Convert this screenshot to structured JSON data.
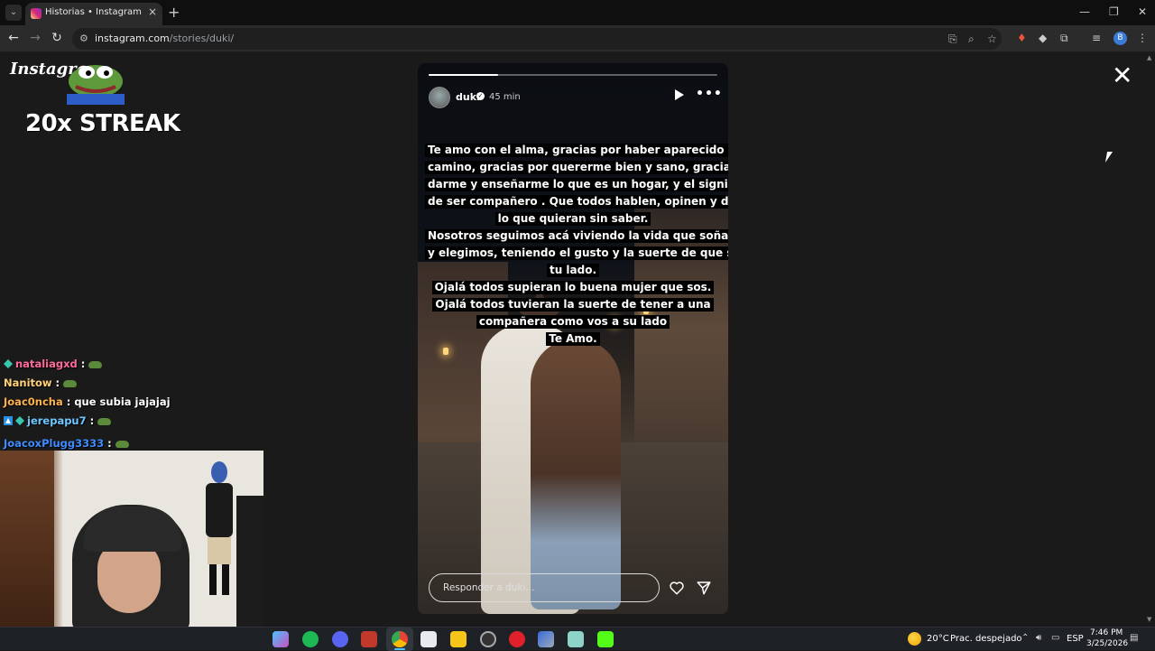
{
  "browser": {
    "tab_title": "Historias • Instagram",
    "tab_close": "×",
    "new_tab": "+",
    "url_domain": "instagram.com",
    "url_path": "/stories/duki/"
  },
  "overlay": {
    "logo_text": "Instagram",
    "streak": "20x STREAK"
  },
  "chat": [
    {
      "user": "nataliagxd",
      "color": "#ff6b9a",
      "message": "",
      "emote": true,
      "badge": "teal"
    },
    {
      "user": "Nanitow",
      "color": "#ffd27a",
      "message": "",
      "emote": true,
      "badge": ""
    },
    {
      "user": "Joac0ncha",
      "color": "#ffb24a",
      "message": "que subia jajajaj",
      "emote": false,
      "badge": ""
    },
    {
      "user": "jerepapu7",
      "color": "#6ec8ff",
      "message": "",
      "emote": true,
      "badge": "blue"
    },
    {
      "user": "JoacoxPlugg3333",
      "color": "#3f8cff",
      "message": "",
      "emote": true,
      "badge": ""
    }
  ],
  "story": {
    "username": "duki",
    "time": "45 min",
    "progress": 0.24,
    "caption_lines": [
      "Te amo con el alma, gracias por haber aparecido en mi",
      "camino, gracias por quererme bien y sano, gracias por",
      "darme y enseñarme lo que es un hogar, y el significado",
      "de ser compañero . Que todos hablen, opinen y digan",
      "lo que quieran sin saber.",
      "Nosotros seguimos acá viviendo la vida  que soñamos",
      "y elegimos, teniendo el gusto y la suerte de que sea a",
      "tu lado.",
      "Ojalá todos supieran lo buena mujer que sos.",
      "Ojalá todos tuvieran la suerte de tener a una",
      "compañera como vos a su lado",
      "Te Amo."
    ],
    "reply_placeholder": "Responder a duki..."
  },
  "taskbar": {
    "temperature": "20°C",
    "weather": "Prac. despejado",
    "language": "ESP",
    "time": "7:46 PM",
    "date": "3/25/2026"
  },
  "colors": {
    "accent": "#4cc2ff",
    "background": "#1a1a1a"
  }
}
